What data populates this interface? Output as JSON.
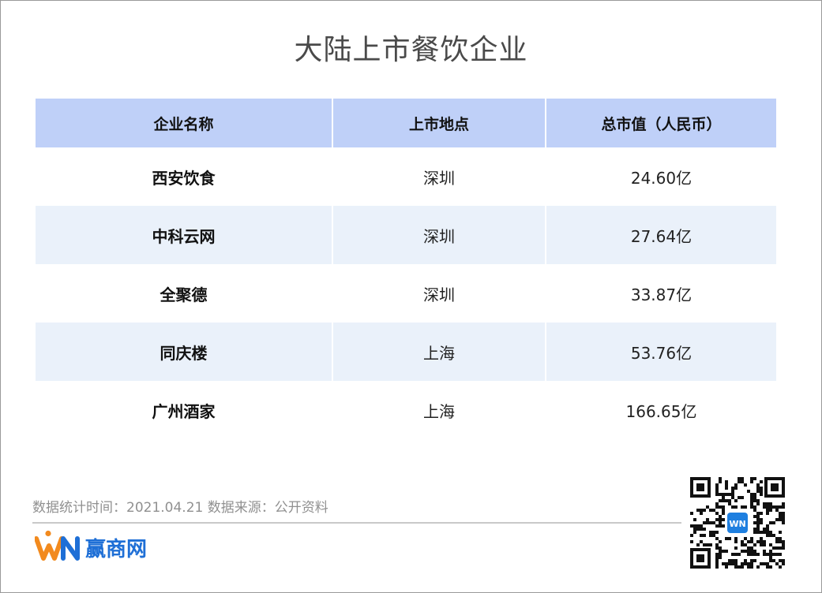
{
  "title": "大陆上市餐饮企业",
  "chart_data": {
    "type": "table",
    "title": "大陆上市餐饮企业",
    "columns": [
      "企业名称",
      "上市地点",
      "总市值（人民币）"
    ],
    "rows": [
      [
        "西安饮食",
        "深圳",
        "24.60亿"
      ],
      [
        "中科云网",
        "深圳",
        "27.64亿"
      ],
      [
        "全聚德",
        "深圳",
        "33.87亿"
      ],
      [
        "同庆楼",
        "上海",
        "53.76亿"
      ],
      [
        "广州酒家",
        "上海",
        "166.65亿"
      ]
    ]
  },
  "footer": {
    "source_text": "数据统计时间：2021.04.21  数据来源：公开资料"
  },
  "brand": {
    "name": "赢商网",
    "color": "#1e6fd6",
    "accent": "#f28a1e",
    "qr_center_label": "WN"
  },
  "colors": {
    "header_bg": "#bfd0f8",
    "alt_row_bg": "#eaf1fa",
    "title_color": "#4a4a4a",
    "footer_text_color": "#909090"
  }
}
